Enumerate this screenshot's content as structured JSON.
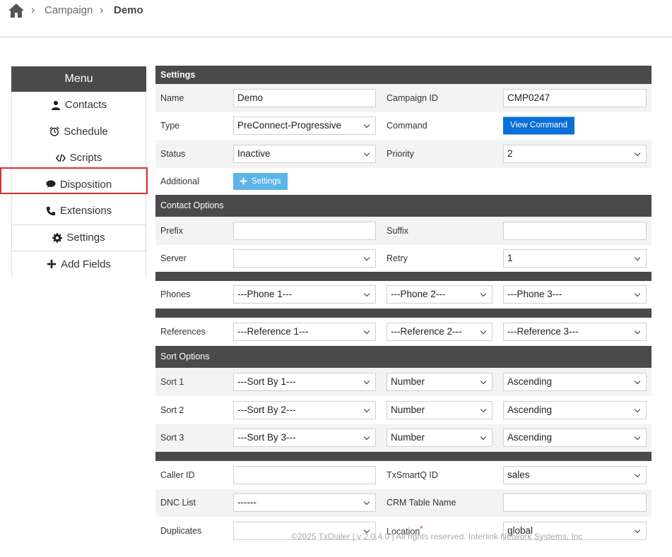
{
  "breadcrumb": {
    "parent": "Campaign",
    "current": "Demo"
  },
  "menu": {
    "title": "Menu",
    "items": [
      {
        "label": "Contacts",
        "icon": "user-icon"
      },
      {
        "label": "Schedule",
        "icon": "alarm-clock-icon"
      },
      {
        "label": "Scripts",
        "icon": "code-icon"
      },
      {
        "label": "Disposition",
        "icon": "chat-bubble-icon"
      },
      {
        "label": "Extensions",
        "icon": "phone-icon"
      },
      {
        "label": "Settings",
        "icon": "gear-icon"
      },
      {
        "label": "Add Fields",
        "icon": "plus-icon"
      }
    ]
  },
  "settings": {
    "title": "Settings",
    "name_label": "Name",
    "name_value": "Demo",
    "campaign_id_label": "Campaign ID",
    "campaign_id_value": "CMP0247",
    "type_label": "Type",
    "type_value": "PreConnect-Progressive",
    "command_label": "Command",
    "view_command_button": "View Command",
    "status_label": "Status",
    "status_value": "Inactive",
    "priority_label": "Priority",
    "priority_value": "2",
    "additional_label": "Additional",
    "additional_button": "Settings"
  },
  "contact_options": {
    "title": "Contact Options",
    "prefix_label": "Prefix",
    "prefix_value": "",
    "suffix_label": "Suffix",
    "suffix_value": "",
    "server_label": "Server",
    "server_value": "",
    "retry_label": "Retry",
    "retry_value": "1",
    "phones_label": "Phones",
    "phones": [
      "---Phone 1---",
      "---Phone 2---",
      "---Phone 3---"
    ],
    "references_label": "References",
    "references": [
      "---Reference 1---",
      "---Reference 2---",
      "---Reference 3---"
    ]
  },
  "sort_options": {
    "title": "Sort Options",
    "rows": [
      {
        "label": "Sort 1",
        "by": "---Sort By 1---",
        "type": "Number",
        "order": "Ascending"
      },
      {
        "label": "Sort 2",
        "by": "---Sort By 2---",
        "type": "Number",
        "order": "Ascending"
      },
      {
        "label": "Sort 3",
        "by": "---Sort By 3---",
        "type": "Number",
        "order": "Ascending"
      }
    ]
  },
  "other": {
    "caller_id_label": "Caller ID",
    "caller_id_value": "",
    "txsmartq_label": "TxSmartQ ID",
    "txsmartq_value": "sales",
    "dnc_label": "DNC List",
    "dnc_value": "------",
    "crm_label": "CRM Table Name",
    "crm_value": "",
    "duplicates_label": "Duplicates",
    "duplicates_value": "",
    "location_label": "Location",
    "location_required": "*",
    "location_value": "global"
  },
  "footer": "©2025 TxDialer | v 2.0.4.0 | All rights reserved. Interlink Network Systems, Inc",
  "colors": {
    "header": "#4a4a4a",
    "primary_button": "#0a6fd6",
    "secondary_button": "#5bb5e8",
    "highlight": "#d93030"
  }
}
